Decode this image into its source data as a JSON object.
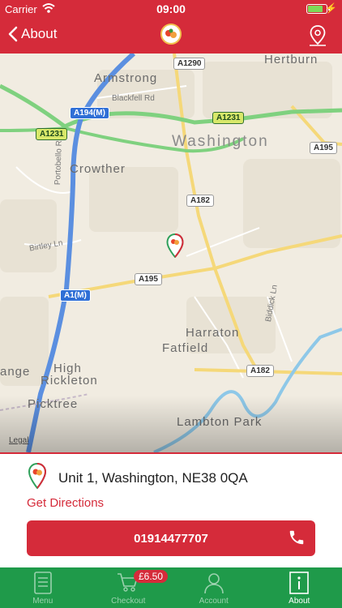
{
  "status_bar": {
    "carrier": "Carrier",
    "time": "09:00"
  },
  "nav": {
    "back_label": "About",
    "back_icon": "chevron-left-icon",
    "right_icon": "map-pin-icon"
  },
  "map": {
    "place_labels": [
      "Hertburn",
      "Armstrong",
      "Washington",
      "Crowther",
      "Harraton",
      "Fatfield",
      "High",
      "Rickleton",
      "Picktree",
      "Lambton Park",
      "ange"
    ],
    "street_labels": [
      "Blackfell Rd",
      "Portobello Rd",
      "Birtley Ln",
      "Biddick Ln"
    ],
    "road_shields": [
      "A1290",
      "A194(M)",
      "A1231",
      "A1231",
      "A195",
      "A182",
      "A195",
      "A1(M)",
      "A182"
    ],
    "legal_label": "Legal"
  },
  "location": {
    "address": "Unit 1, Washington, NE38 0QA",
    "directions_label": "Get Directions",
    "phone": "01914477707"
  },
  "tabs": [
    {
      "label": "Menu",
      "icon": "menu-icon",
      "active": false
    },
    {
      "label": "Checkout",
      "icon": "cart-icon",
      "active": false
    },
    {
      "label": "Account",
      "icon": "account-icon",
      "active": false
    },
    {
      "label": "About",
      "icon": "info-icon",
      "active": true
    }
  ],
  "cart_badge": "£6.50",
  "colors": {
    "brand_red": "#d52b3a",
    "tab_green": "#1f9a4a"
  }
}
